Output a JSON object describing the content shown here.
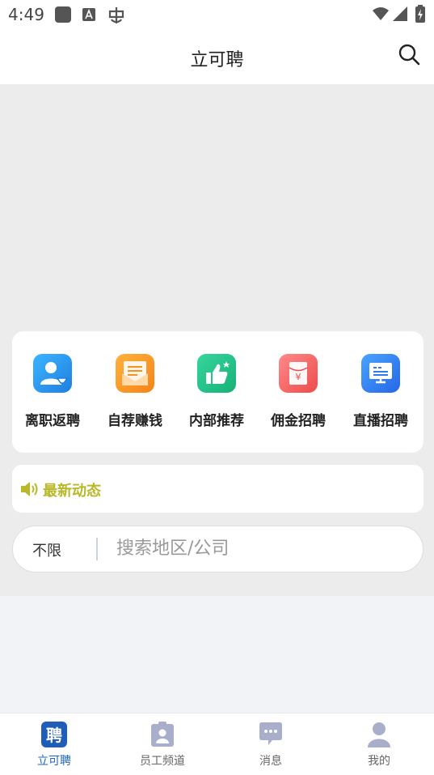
{
  "status_bar": {
    "time": "4:49"
  },
  "header": {
    "title": "立可聘"
  },
  "features": [
    {
      "label": "离职返聘",
      "icon": "rehire-user-icon",
      "color": "#1e90e8"
    },
    {
      "label": "自荐赚钱",
      "icon": "envelope-icon",
      "color": "#f6921e"
    },
    {
      "label": "内部推荐",
      "icon": "thumbs-up-icon",
      "color": "#22c38a"
    },
    {
      "label": "佣金招聘",
      "icon": "red-packet-icon",
      "color": "#f45c5c"
    },
    {
      "label": "直播招聘",
      "icon": "live-screen-icon",
      "color": "#2f7af0"
    }
  ],
  "news": {
    "label": "最新动态",
    "color": "#b8b82a"
  },
  "search": {
    "filter": "不限",
    "placeholder": "搜索地区/公司"
  },
  "tabs": [
    {
      "label": "立可聘",
      "icon": "pin-logo-icon",
      "active": true
    },
    {
      "label": "员工频道",
      "icon": "badge-icon",
      "active": false
    },
    {
      "label": "消息",
      "icon": "chat-bubble-icon",
      "active": false
    },
    {
      "label": "我的",
      "icon": "person-icon",
      "active": false
    }
  ],
  "colors": {
    "accent": "#1a64c4"
  }
}
